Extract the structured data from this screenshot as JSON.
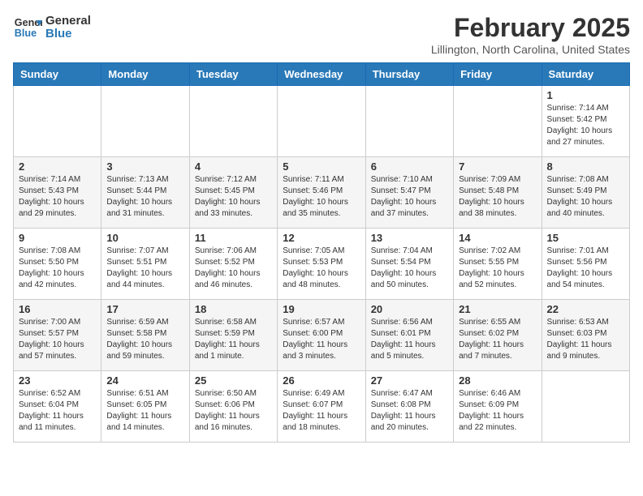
{
  "header": {
    "logo_line1": "General",
    "logo_line2": "Blue",
    "month": "February 2025",
    "location": "Lillington, North Carolina, United States"
  },
  "weekdays": [
    "Sunday",
    "Monday",
    "Tuesday",
    "Wednesday",
    "Thursday",
    "Friday",
    "Saturday"
  ],
  "weeks": [
    [
      {
        "day": "",
        "info": ""
      },
      {
        "day": "",
        "info": ""
      },
      {
        "day": "",
        "info": ""
      },
      {
        "day": "",
        "info": ""
      },
      {
        "day": "",
        "info": ""
      },
      {
        "day": "",
        "info": ""
      },
      {
        "day": "1",
        "info": "Sunrise: 7:14 AM\nSunset: 5:42 PM\nDaylight: 10 hours and 27 minutes."
      }
    ],
    [
      {
        "day": "2",
        "info": "Sunrise: 7:14 AM\nSunset: 5:43 PM\nDaylight: 10 hours and 29 minutes."
      },
      {
        "day": "3",
        "info": "Sunrise: 7:13 AM\nSunset: 5:44 PM\nDaylight: 10 hours and 31 minutes."
      },
      {
        "day": "4",
        "info": "Sunrise: 7:12 AM\nSunset: 5:45 PM\nDaylight: 10 hours and 33 minutes."
      },
      {
        "day": "5",
        "info": "Sunrise: 7:11 AM\nSunset: 5:46 PM\nDaylight: 10 hours and 35 minutes."
      },
      {
        "day": "6",
        "info": "Sunrise: 7:10 AM\nSunset: 5:47 PM\nDaylight: 10 hours and 37 minutes."
      },
      {
        "day": "7",
        "info": "Sunrise: 7:09 AM\nSunset: 5:48 PM\nDaylight: 10 hours and 38 minutes."
      },
      {
        "day": "8",
        "info": "Sunrise: 7:08 AM\nSunset: 5:49 PM\nDaylight: 10 hours and 40 minutes."
      }
    ],
    [
      {
        "day": "9",
        "info": "Sunrise: 7:08 AM\nSunset: 5:50 PM\nDaylight: 10 hours and 42 minutes."
      },
      {
        "day": "10",
        "info": "Sunrise: 7:07 AM\nSunset: 5:51 PM\nDaylight: 10 hours and 44 minutes."
      },
      {
        "day": "11",
        "info": "Sunrise: 7:06 AM\nSunset: 5:52 PM\nDaylight: 10 hours and 46 minutes."
      },
      {
        "day": "12",
        "info": "Sunrise: 7:05 AM\nSunset: 5:53 PM\nDaylight: 10 hours and 48 minutes."
      },
      {
        "day": "13",
        "info": "Sunrise: 7:04 AM\nSunset: 5:54 PM\nDaylight: 10 hours and 50 minutes."
      },
      {
        "day": "14",
        "info": "Sunrise: 7:02 AM\nSunset: 5:55 PM\nDaylight: 10 hours and 52 minutes."
      },
      {
        "day": "15",
        "info": "Sunrise: 7:01 AM\nSunset: 5:56 PM\nDaylight: 10 hours and 54 minutes."
      }
    ],
    [
      {
        "day": "16",
        "info": "Sunrise: 7:00 AM\nSunset: 5:57 PM\nDaylight: 10 hours and 57 minutes."
      },
      {
        "day": "17",
        "info": "Sunrise: 6:59 AM\nSunset: 5:58 PM\nDaylight: 10 hours and 59 minutes."
      },
      {
        "day": "18",
        "info": "Sunrise: 6:58 AM\nSunset: 5:59 PM\nDaylight: 11 hours and 1 minute."
      },
      {
        "day": "19",
        "info": "Sunrise: 6:57 AM\nSunset: 6:00 PM\nDaylight: 11 hours and 3 minutes."
      },
      {
        "day": "20",
        "info": "Sunrise: 6:56 AM\nSunset: 6:01 PM\nDaylight: 11 hours and 5 minutes."
      },
      {
        "day": "21",
        "info": "Sunrise: 6:55 AM\nSunset: 6:02 PM\nDaylight: 11 hours and 7 minutes."
      },
      {
        "day": "22",
        "info": "Sunrise: 6:53 AM\nSunset: 6:03 PM\nDaylight: 11 hours and 9 minutes."
      }
    ],
    [
      {
        "day": "23",
        "info": "Sunrise: 6:52 AM\nSunset: 6:04 PM\nDaylight: 11 hours and 11 minutes."
      },
      {
        "day": "24",
        "info": "Sunrise: 6:51 AM\nSunset: 6:05 PM\nDaylight: 11 hours and 14 minutes."
      },
      {
        "day": "25",
        "info": "Sunrise: 6:50 AM\nSunset: 6:06 PM\nDaylight: 11 hours and 16 minutes."
      },
      {
        "day": "26",
        "info": "Sunrise: 6:49 AM\nSunset: 6:07 PM\nDaylight: 11 hours and 18 minutes."
      },
      {
        "day": "27",
        "info": "Sunrise: 6:47 AM\nSunset: 6:08 PM\nDaylight: 11 hours and 20 minutes."
      },
      {
        "day": "28",
        "info": "Sunrise: 6:46 AM\nSunset: 6:09 PM\nDaylight: 11 hours and 22 minutes."
      },
      {
        "day": "",
        "info": ""
      }
    ]
  ]
}
